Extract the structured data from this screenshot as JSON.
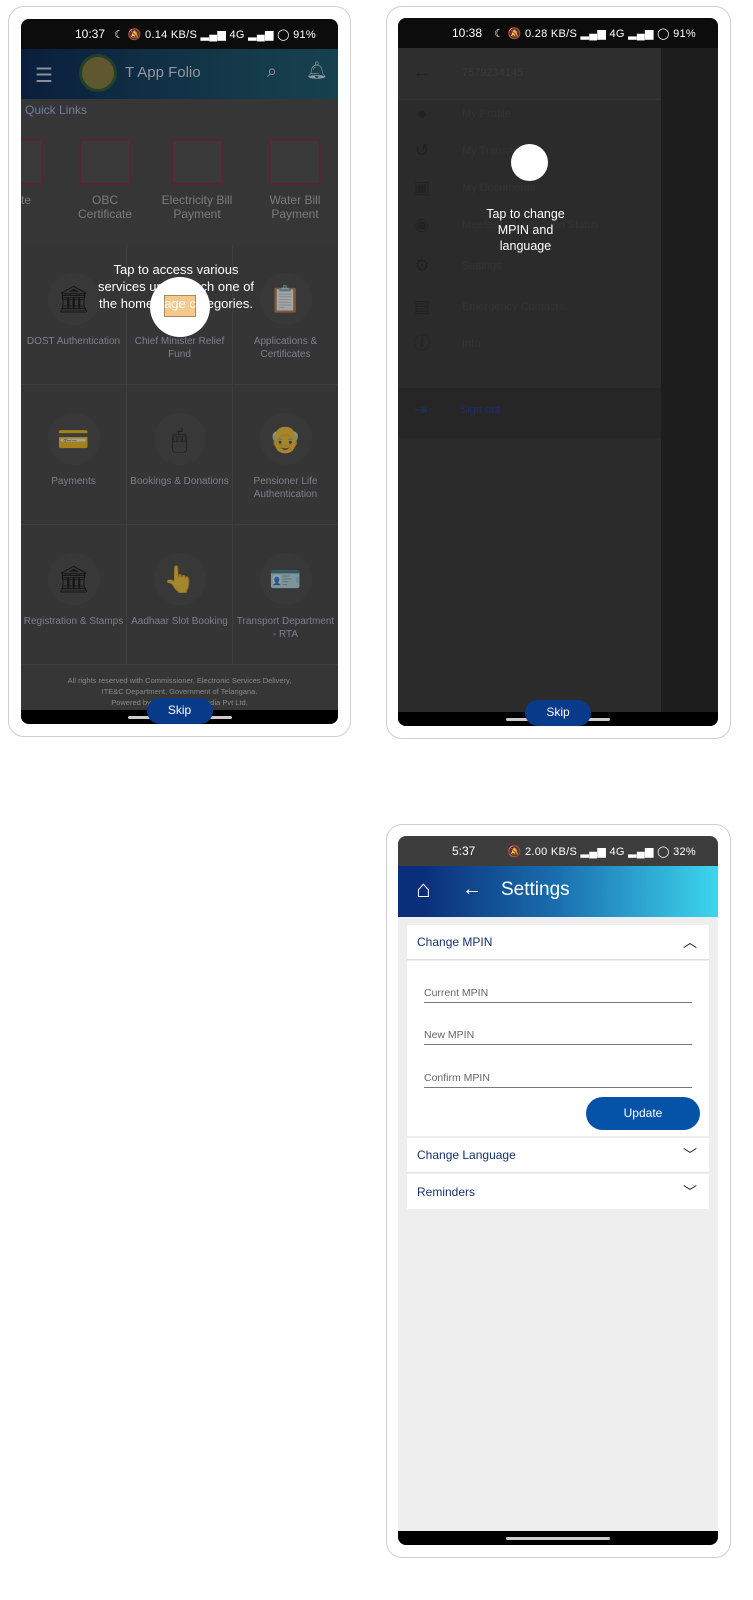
{
  "home": {
    "status": {
      "time": "10:37",
      "icons": "☾ 🔕 0.14 KB/S ▂▄▆ 4G ▂▄▆ ◯",
      "battery": "91%"
    },
    "app_title": "T App Folio",
    "quick_links_title": "Quick Links",
    "quick_links": [
      "ence ate",
      "OBC Certificate",
      "Electricity Bill Payment",
      "Water Bill Payment"
    ],
    "categories": [
      "DOST Authentication",
      "Chief Minister Relief Fund",
      "Applications & Certificates",
      "Payments",
      "Bookings & Donations",
      "Pensioner Life Authentication",
      "Registration & Stamps",
      "Aadhaar Slot Booking",
      "Transport Department - RTA"
    ],
    "footer": [
      "All rights reserved with Commissioner, Electronic Services Delivery,",
      "ITE&C Department, Government of Telangana.",
      "Powered by Tech Mahindra India Pvt Ltd."
    ],
    "tooltip": [
      "Tap to access various",
      "services under each one of",
      "the home page categories."
    ],
    "skip_label": "Skip"
  },
  "drawer": {
    "status": {
      "time": "10:38",
      "icons": "☾ 🔕 0.28 KB/S ▂▄▆ 4G ▂▄▆ ◯",
      "battery": "91%"
    },
    "phone": "7579234145",
    "items": [
      {
        "label": "My Profile",
        "icon": "account-circle-icon"
      },
      {
        "label": "My Transactions",
        "icon": "history-icon"
      },
      {
        "label": "My Documents",
        "icon": "photo-library-icon"
      },
      {
        "label": "MeeSeva Application Status",
        "icon": "eye-icon"
      },
      {
        "label": "Settings",
        "icon": "gear-icon"
      },
      {
        "label": "Emergency Contacts",
        "icon": "contact-card-icon"
      },
      {
        "label": "Info",
        "icon": "info-icon"
      }
    ],
    "sign_out": "Sign out",
    "tooltip": [
      "Tap to change",
      "MPIN and",
      "language"
    ],
    "skip_label": "Skip"
  },
  "settings": {
    "status": {
      "time": "5:37",
      "icons": "🔕 2.00 KB/S ▂▄▆ 4G ▂▄▆ ◯",
      "battery": "32%"
    },
    "title": "Settings",
    "change_mpin": "Change MPIN",
    "fields": {
      "current": "Current MPIN",
      "new": "New MPIN",
      "confirm": "Confirm MPIN"
    },
    "update_label": "Update",
    "change_language": "Change Language",
    "reminders": "Reminders",
    "colors": {
      "header_start": "#0a2f7a",
      "header_end": "#3dd6ee",
      "button": "#0553a8",
      "section_text": "#14336e"
    }
  }
}
